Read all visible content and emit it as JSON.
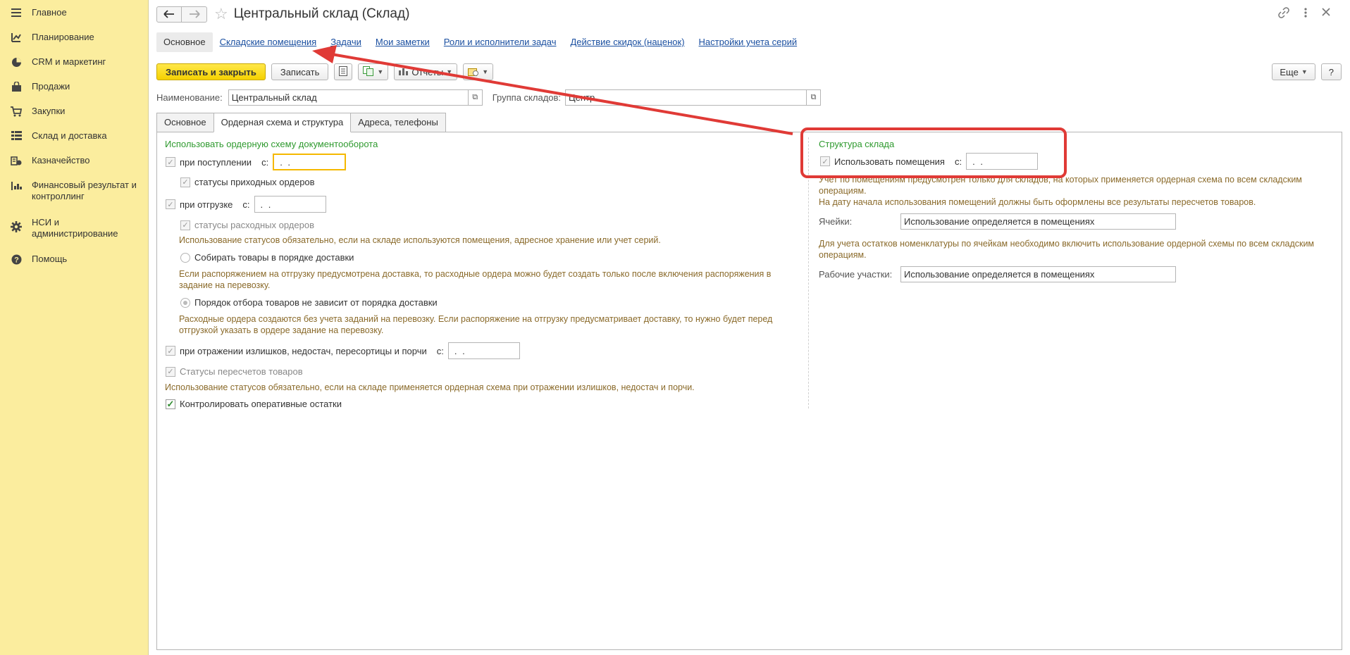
{
  "sidebar": {
    "items": [
      {
        "label": "Главное",
        "icon": "menu-icon"
      },
      {
        "label": "Планирование",
        "icon": "planning-icon"
      },
      {
        "label": "CRM и маркетинг",
        "icon": "pie-chart-icon"
      },
      {
        "label": "Продажи",
        "icon": "bag-icon"
      },
      {
        "label": "Закупки",
        "icon": "cart-icon"
      },
      {
        "label": "Склад и доставка",
        "icon": "grid-icon"
      },
      {
        "label": "Казначейство",
        "icon": "treasury-icon"
      },
      {
        "label": "Финансовый результат и контроллинг",
        "icon": "bar-chart-icon"
      },
      {
        "label": "НСИ и администрирование",
        "icon": "gear-icon"
      },
      {
        "label": "Помощь",
        "icon": "help-icon"
      }
    ]
  },
  "header": {
    "title": "Центральный склад (Склад)"
  },
  "top_tabs": [
    "Основное",
    "Складские помещения",
    "Задачи",
    "Мои заметки",
    "Роли и исполнители задач",
    "Действие скидок (наценок)",
    "Настройки учета серий"
  ],
  "toolbar": {
    "save_close": "Записать и закрыть",
    "save": "Записать",
    "reports": "Отчеты",
    "more": "Еще",
    "help": "?"
  },
  "form": {
    "name_label": "Наименование:",
    "name_value": "Центральный склад",
    "group_label": "Группа складов:",
    "group_value": "Центр"
  },
  "inner_tabs": [
    "Основное",
    "Ордерная схема и структура",
    "Адреса, телефоны"
  ],
  "left": {
    "section_title": "Использовать ордерную схему документооборота",
    "on_receipt": "при поступлении",
    "from": "с:",
    "date_empty": " .  . ",
    "receipt_statuses": "статусы приходных ордеров",
    "on_shipment": "при отгрузке",
    "shipment_statuses": "статусы расходных ордеров",
    "statuses_note": "Использование статусов обязательно, если на складе используются помещения, адресное хранение или учет серий.",
    "radio1": "Собирать товары в порядке доставки",
    "radio1_note": "Если распоряжением на отгрузку предусмотрена доставка, то расходные ордера можно будет создать только после включения распоряжения в задание на перевозку.",
    "radio2": "Порядок отбора товаров не зависит от порядка доставки",
    "radio2_note": "Расходные ордера создаются без учета заданий на перевозку. Если распоряжение на отгрузку предусматривает доставку, то нужно будет перед отгрузкой указать в ордере задание на перевозку.",
    "on_surplus": "при отражении излишков, недостач, пересортицы и порчи",
    "recount_statuses": "Статусы пересчетов товаров",
    "recount_note": "Использование статусов обязательно, если на складе применяется ордерная схема при отражении излишков, недостач и порчи.",
    "control_stock": "Контролировать оперативные остатки"
  },
  "right": {
    "section_title": "Структура склада",
    "use_rooms": "Использовать помещения",
    "from": "с:",
    "date_empty": " .  . ",
    "rooms_note": "Учет по помещениям предусмотрен только для складов, на которых применяется ордерная схема по всем складским операциям.\nНа дату начала использования помещений должны быть оформлены все результаты пересчетов товаров.",
    "cells_label": "Ячейки:",
    "cells_value": "Использование определяется в помещениях",
    "cells_note": "Для учета остатков номенклатуры по ячейкам необходимо включить использование ордерной схемы по всем складским операциям.",
    "work_areas_label": "Рабочие участки:",
    "work_areas_value": "Использование определяется в помещениях"
  },
  "colors": {
    "sidebar_bg": "#fbed9e",
    "primary_btn": "#f5d100",
    "accent_green": "#2f9a2f",
    "note_brown": "#8a6a2a",
    "highlight_red": "#e03a36",
    "link_blue": "#1a4fa0"
  }
}
